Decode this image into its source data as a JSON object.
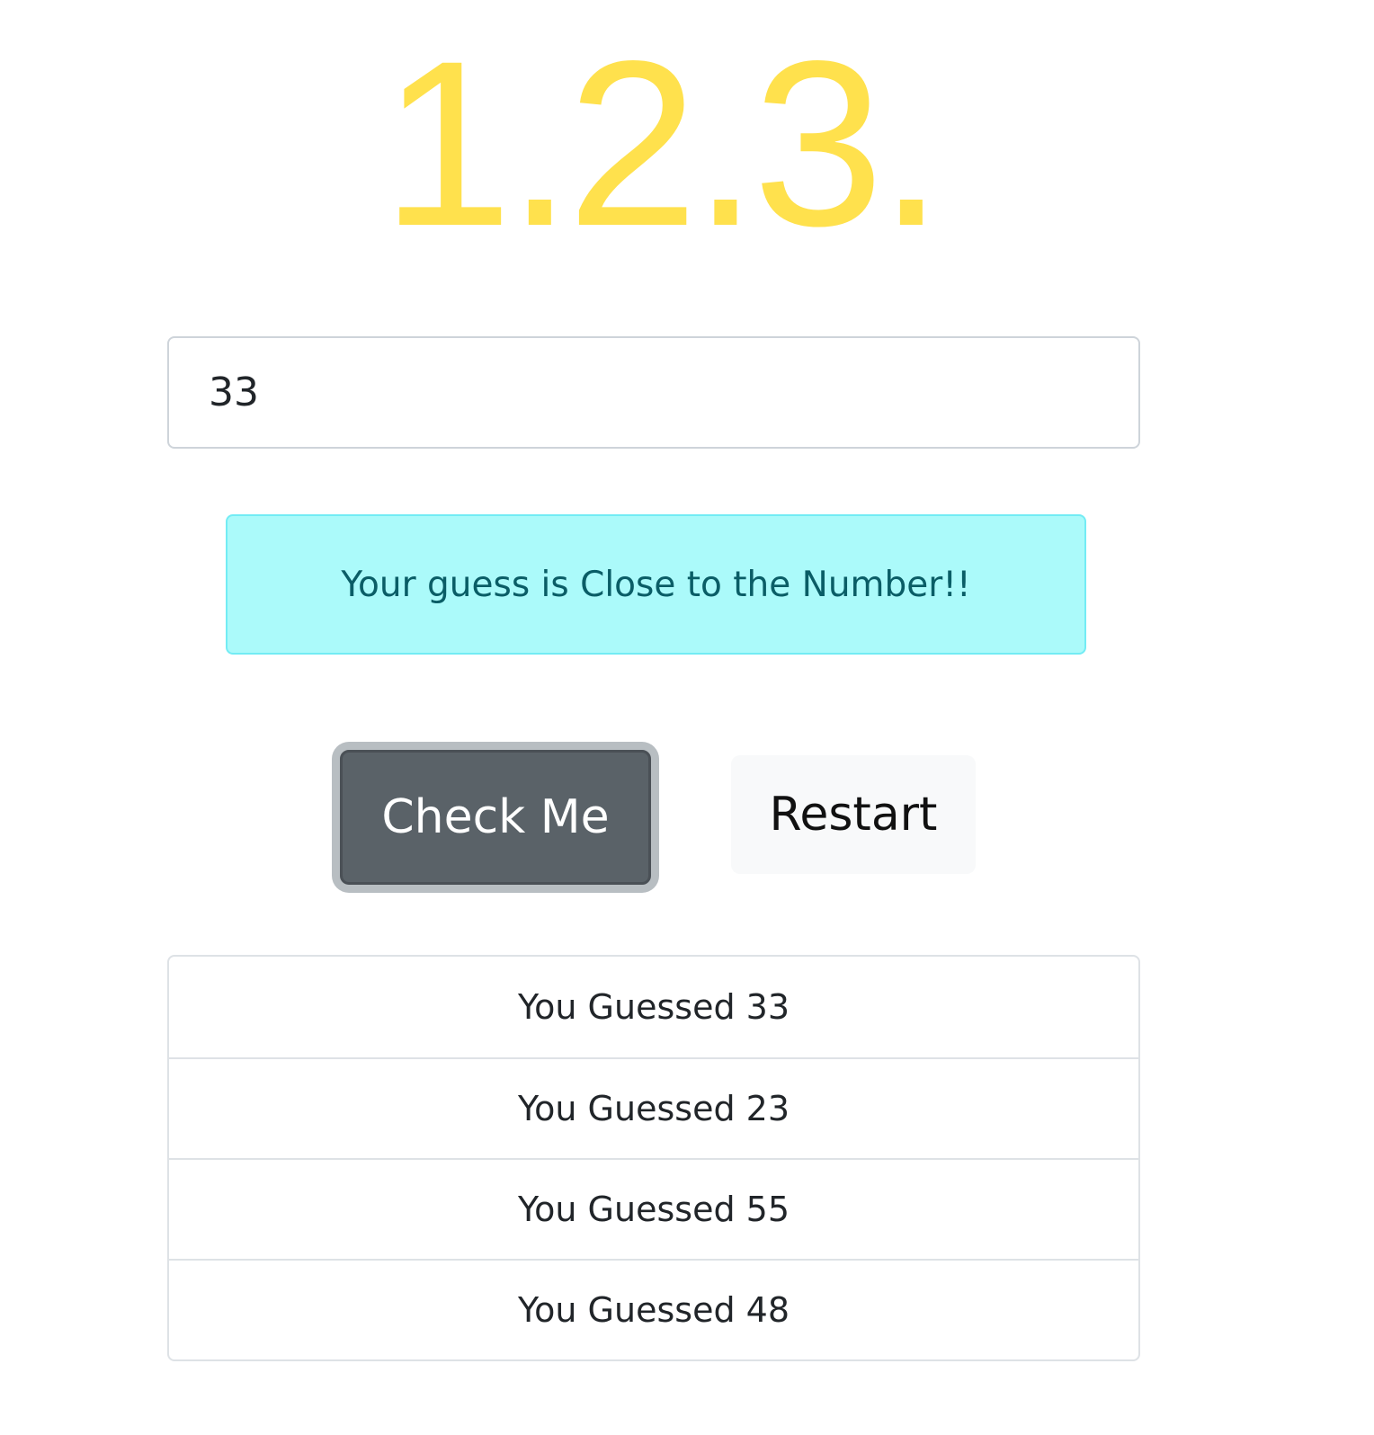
{
  "header": {
    "title": "1.2.3."
  },
  "input": {
    "value": "33"
  },
  "alert": {
    "message": "Your guess is Close to the Number!!"
  },
  "buttons": {
    "check_label": "Check Me",
    "restart_label": "Restart"
  },
  "guesses": [
    "You Guessed 33",
    "You Guessed 23",
    "You Guessed 55",
    "You Guessed 48"
  ],
  "colors": {
    "title": "#ffe14d",
    "alert_bg": "#abfafa",
    "alert_text": "#0a5d66",
    "check_button_bg": "#5a6268",
    "restart_button_bg": "#f8f9fa"
  }
}
